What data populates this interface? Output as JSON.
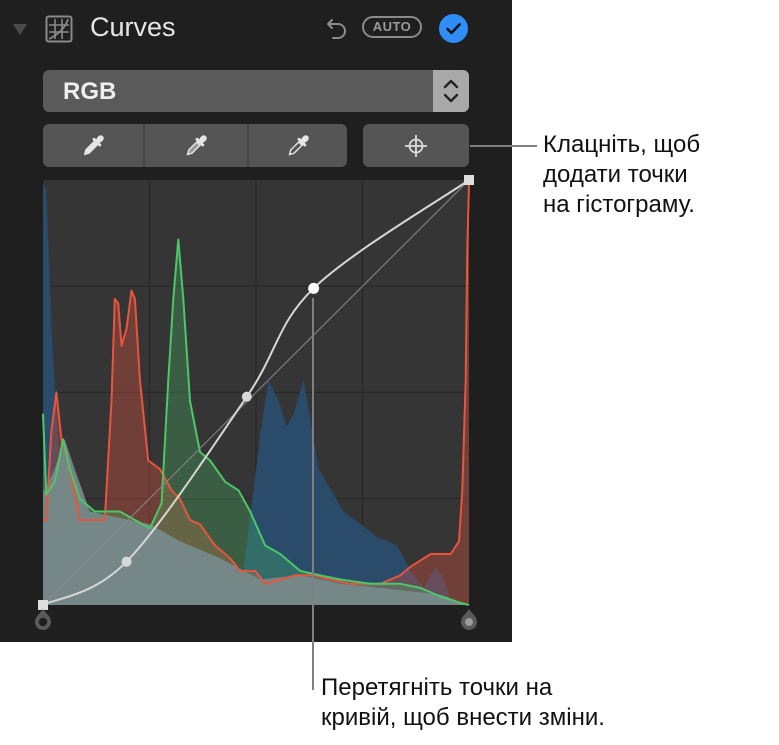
{
  "panel": {
    "title": "Curves",
    "auto_label": "AUTO",
    "channel_select": {
      "value": "RGB"
    },
    "icons": {
      "disclosure": "disclosure-triangle-icon",
      "curves": "curves-icon",
      "undo": "undo-icon",
      "done": "checkmark-icon",
      "select_arrows": "chevron-up-down-icon",
      "black_point": "eyedropper-black-icon",
      "gray_point": "eyedropper-gray-icon",
      "white_point": "eyedropper-white-icon",
      "add_points": "crosshair-icon"
    },
    "colors": {
      "accent": "#2f8ef5",
      "red": "#e8553f",
      "green": "#4cc767",
      "blue": "#2a4d6e",
      "luminance": "#778a8b"
    }
  },
  "callouts": {
    "add_points": [
      "Клацніть, щоб",
      "додати точки",
      "на гістограму."
    ],
    "drag_points": [
      "Перетягніть точки на",
      "кривій, щоб внести зміни."
    ]
  },
  "chart_data": {
    "type": "area",
    "title": "Curves",
    "xlabel": "",
    "ylabel": "",
    "xlim": [
      0,
      255
    ],
    "ylim": [
      0,
      1
    ],
    "grid": true,
    "grid_divisions": 4,
    "curve_points": [
      {
        "input": 0,
        "output": 0
      },
      {
        "input": 50,
        "output": 26
      },
      {
        "input": 122,
        "output": 125
      },
      {
        "input": 162,
        "output": 190
      },
      {
        "input": 255,
        "output": 255
      }
    ],
    "black_point": 0,
    "white_point": 255,
    "series": [
      {
        "name": "Blue",
        "points": [
          [
            0,
            0.99
          ],
          [
            2,
            0.98
          ],
          [
            5,
            0.65
          ],
          [
            10,
            0.32
          ],
          [
            16,
            0.22
          ],
          [
            28,
            0.21
          ],
          [
            60,
            0.19
          ],
          [
            120,
            0.08
          ],
          [
            130,
            0.4
          ],
          [
            135,
            0.53
          ],
          [
            141,
            0.48
          ],
          [
            146,
            0.42
          ],
          [
            150,
            0.45
          ],
          [
            156,
            0.53
          ],
          [
            165,
            0.32
          ],
          [
            180,
            0.22
          ],
          [
            187,
            0.2
          ],
          [
            200,
            0.16
          ],
          [
            212,
            0.14
          ],
          [
            220,
            0.08
          ],
          [
            228,
            0.04
          ],
          [
            235,
            0.09
          ],
          [
            240,
            0.06
          ],
          [
            245,
            0.0
          ],
          [
            255,
            0.0
          ]
        ]
      },
      {
        "name": "Green",
        "points": [
          [
            0,
            0.45
          ],
          [
            2,
            0.26
          ],
          [
            7,
            0.29
          ],
          [
            12,
            0.39
          ],
          [
            16,
            0.32
          ],
          [
            22,
            0.25
          ],
          [
            31,
            0.22
          ],
          [
            46,
            0.22
          ],
          [
            55,
            0.2
          ],
          [
            64,
            0.18
          ],
          [
            71,
            0.24
          ],
          [
            75,
            0.53
          ],
          [
            78,
            0.72
          ],
          [
            81,
            0.86
          ],
          [
            84,
            0.72
          ],
          [
            88,
            0.48
          ],
          [
            94,
            0.36
          ],
          [
            100,
            0.34
          ],
          [
            109,
            0.29
          ],
          [
            117,
            0.27
          ],
          [
            124,
            0.22
          ],
          [
            133,
            0.14
          ],
          [
            142,
            0.12
          ],
          [
            154,
            0.08
          ],
          [
            166,
            0.07
          ],
          [
            178,
            0.06
          ],
          [
            196,
            0.05
          ],
          [
            214,
            0.05
          ],
          [
            226,
            0.04
          ],
          [
            238,
            0.02
          ],
          [
            250,
            0.005
          ],
          [
            255,
            0.0
          ]
        ]
      },
      {
        "name": "Red",
        "points": [
          [
            0,
            0.2
          ],
          [
            2,
            0.2
          ],
          [
            5,
            0.41
          ],
          [
            8,
            0.5
          ],
          [
            11,
            0.39
          ],
          [
            15,
            0.34
          ],
          [
            22,
            0.2
          ],
          [
            31,
            0.2
          ],
          [
            37,
            0.2
          ],
          [
            41,
            0.48
          ],
          [
            43,
            0.72
          ],
          [
            45,
            0.71
          ],
          [
            47,
            0.61
          ],
          [
            50,
            0.65
          ],
          [
            53,
            0.74
          ],
          [
            55,
            0.72
          ],
          [
            58,
            0.53
          ],
          [
            63,
            0.34
          ],
          [
            70,
            0.32
          ],
          [
            77,
            0.27
          ],
          [
            82,
            0.25
          ],
          [
            88,
            0.2
          ],
          [
            94,
            0.19
          ],
          [
            103,
            0.14
          ],
          [
            112,
            0.11
          ],
          [
            118,
            0.08
          ],
          [
            127,
            0.08
          ],
          [
            133,
            0.05
          ],
          [
            142,
            0.06
          ],
          [
            151,
            0.07
          ],
          [
            163,
            0.07
          ],
          [
            172,
            0.06
          ],
          [
            184,
            0.05
          ],
          [
            202,
            0.05
          ],
          [
            214,
            0.07
          ],
          [
            220,
            0.09
          ],
          [
            232,
            0.12
          ],
          [
            244,
            0.12
          ],
          [
            249,
            0.15
          ],
          [
            251,
            0.27
          ],
          [
            253,
            0.53
          ],
          [
            254,
            0.84
          ],
          [
            255,
            0.99
          ]
        ]
      },
      {
        "name": "Luminance",
        "points": [
          [
            0,
            0.27
          ],
          [
            1,
            0.27
          ],
          [
            7,
            0.32
          ],
          [
            13,
            0.39
          ],
          [
            19,
            0.32
          ],
          [
            28,
            0.22
          ],
          [
            40,
            0.21
          ],
          [
            64,
            0.19
          ],
          [
            82,
            0.15
          ],
          [
            106,
            0.11
          ],
          [
            130,
            0.06
          ],
          [
            154,
            0.07
          ],
          [
            178,
            0.05
          ],
          [
            214,
            0.035
          ],
          [
            238,
            0.024
          ],
          [
            255,
            0.0
          ]
        ]
      }
    ]
  }
}
